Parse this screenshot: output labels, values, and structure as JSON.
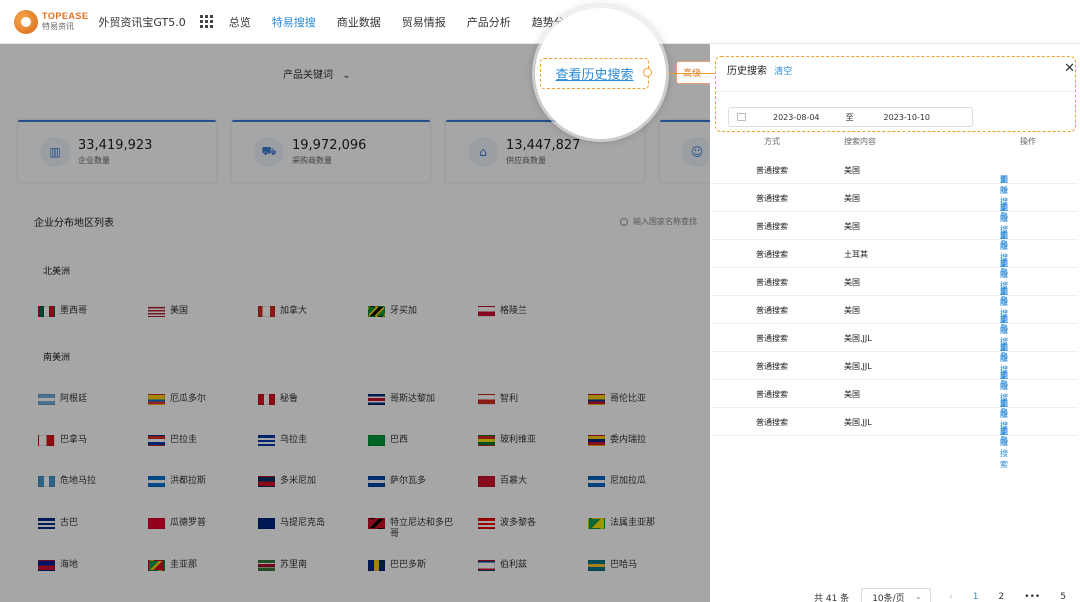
{
  "header": {
    "logo_en": "TOPEASE",
    "logo_cn": "特易资讯",
    "app_title": "外贸资讯宝GT5.0",
    "nav": [
      {
        "label": "总览",
        "active": false
      },
      {
        "label": "特易搜搜",
        "active": true
      },
      {
        "label": "商业数据",
        "active": false
      },
      {
        "label": "贸易情报",
        "active": false
      },
      {
        "label": "产品分析",
        "active": false
      },
      {
        "label": "趋势分析",
        "active": false
      }
    ]
  },
  "filter": {
    "keyword_dropdown": "产品关键词"
  },
  "peek_button": "高级",
  "stats": [
    {
      "value": "33,419,923",
      "label": "企业数量",
      "icon": "building-icon"
    },
    {
      "value": "19,972,096",
      "label": "采购商数量",
      "icon": "cart-icon"
    },
    {
      "value": "13,447,827",
      "label": "供应商数量",
      "icon": "shop-icon"
    }
  ],
  "section_title": "企业分布地区列表",
  "search_placeholder": "输入国家名称查找",
  "regions": [
    {
      "name": "北美洲",
      "countries": [
        "墨西哥",
        "美国",
        "加拿大",
        "牙买加",
        "格陵兰"
      ]
    },
    {
      "name": "南美洲",
      "countries": [
        "阿根廷",
        "厄瓜多尔",
        "秘鲁",
        "哥斯达黎加",
        "智利",
        "哥伦比亚",
        "巴拿马",
        "巴拉圭",
        "乌拉圭",
        "巴西",
        "玻利维亚",
        "委内瑞拉",
        "危地马拉",
        "洪都拉斯",
        "多米尼加",
        "萨尔瓦多",
        "百慕大",
        "尼加拉瓜",
        "古巴",
        "瓜德罗普",
        "马提尼克岛",
        "特立尼达和多巴哥",
        "波多黎各",
        "法属圭亚那",
        "海地",
        "圭亚那",
        "苏里南",
        "巴巴多斯",
        "伯利兹",
        "巴哈马"
      ]
    }
  ],
  "history": {
    "callout_label": "查看历史搜索",
    "title": "历史搜索",
    "clear": "清空",
    "date_from": "2023-08-04",
    "date_sep": "至",
    "date_to": "2023-10-10",
    "columns": {
      "method": "方式",
      "content": "搜索内容",
      "action": "操作"
    },
    "action_research": "重新搜索",
    "action_delete": "删除",
    "action_sep": "|",
    "rows": [
      {
        "method": "普通搜索",
        "content": "美国"
      },
      {
        "method": "普通搜索",
        "content": "美国"
      },
      {
        "method": "普通搜索",
        "content": "美国"
      },
      {
        "method": "普通搜索",
        "content": "土耳其"
      },
      {
        "method": "普通搜索",
        "content": "美国"
      },
      {
        "method": "普通搜索",
        "content": "美国"
      },
      {
        "method": "普通搜索",
        "content": "美国,JJL"
      },
      {
        "method": "普通搜索",
        "content": "美国,JJL"
      },
      {
        "method": "普通搜索",
        "content": "美国"
      },
      {
        "method": "普通搜索",
        "content": "美国,JJL"
      }
    ],
    "pagination": {
      "total": "共 41 条",
      "page_size": "10条/页",
      "pages": [
        "1",
        "2",
        "•••",
        "5"
      ],
      "current": "1"
    }
  }
}
